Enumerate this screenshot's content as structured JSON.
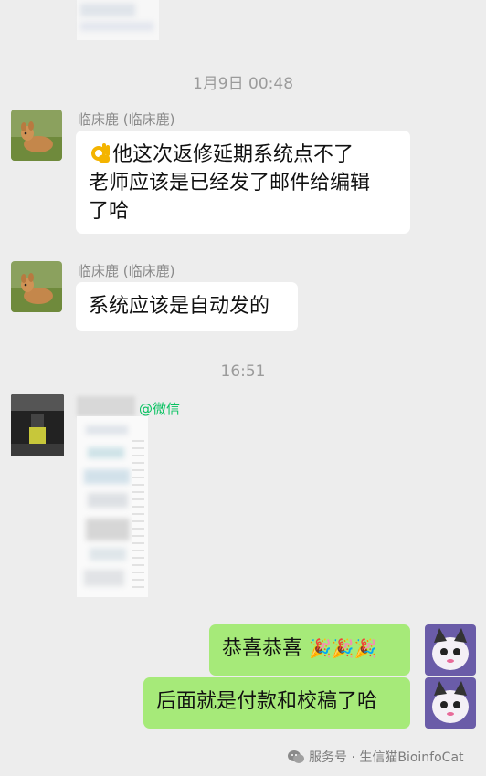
{
  "messages": {
    "time1": "1月9日 00:48",
    "time2": "16:51",
    "m1": {
      "sender": "临床鹿 (临床鹿)",
      "line1": "他这次返修延期系统点不了",
      "line2": "老师应该是已经发了邮件给编辑",
      "line3": "了哈",
      "emoji": "ok-hand-icon"
    },
    "m2": {
      "sender": "临床鹿 (临床鹿)",
      "text": "系统应该是自动发的"
    },
    "m3": {
      "sender_suffix": "@微信"
    },
    "m4": {
      "text": "恭喜恭喜"
    },
    "m5": {
      "text": "后面就是付款和校稿了哈"
    }
  },
  "watermark": {
    "text": "服务号 · 生信猫BioinfoCat",
    "icon": "wechat-icon"
  },
  "colors": {
    "bg": "#ededed",
    "my_bubble": "#a0e75a",
    "other_bubble": "#ffffff",
    "wechat_green": "#07c160"
  }
}
